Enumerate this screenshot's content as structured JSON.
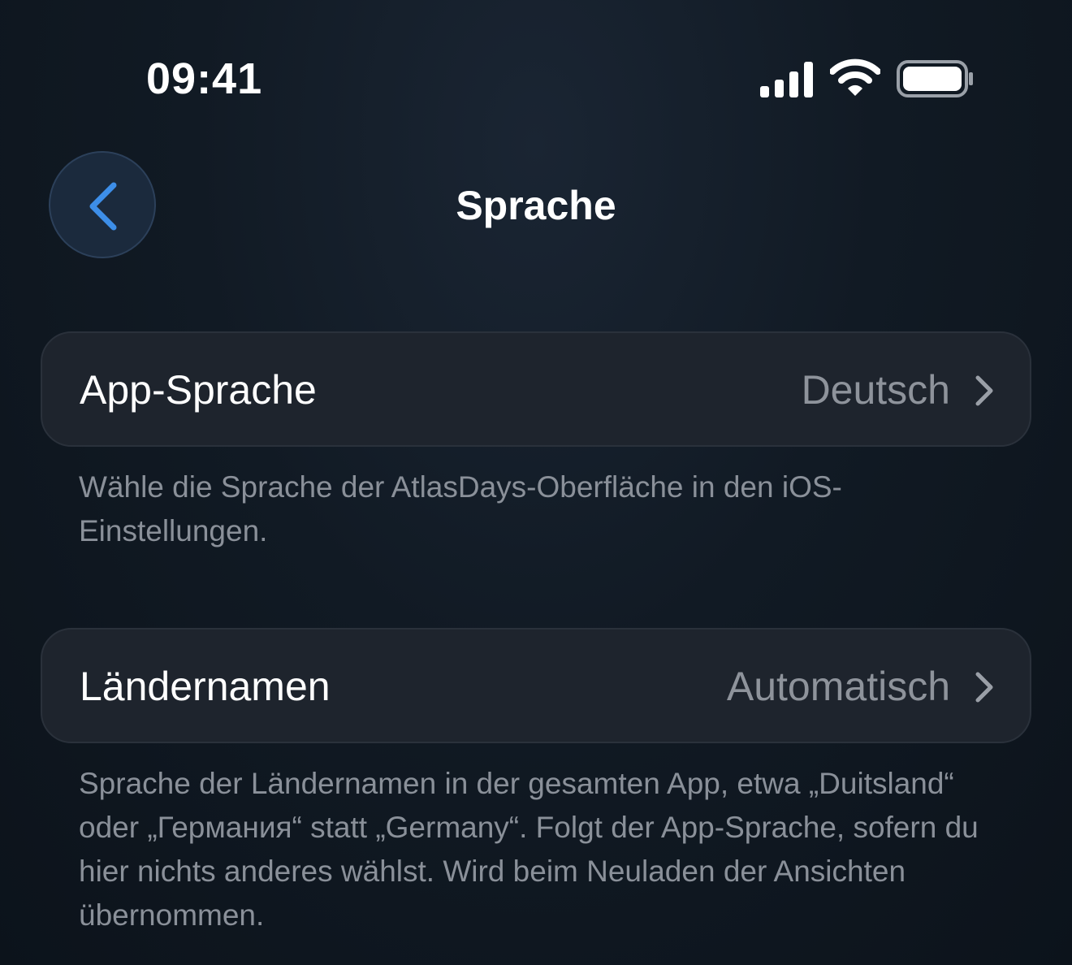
{
  "status_bar": {
    "time": "09:41",
    "icons": [
      "signal-icon",
      "wifi-icon",
      "battery-icon"
    ]
  },
  "nav": {
    "back_icon": "chevron-left-icon",
    "title": "Sprache"
  },
  "settings": {
    "app_language": {
      "label": "App-Sprache",
      "value": "Deutsch",
      "description": "Wähle die Sprache der AtlasDays-Oberfläche in den iOS-Einstellungen."
    },
    "country_names": {
      "label": "Ländernamen",
      "value": "Automatisch",
      "description": "Sprache der Ländernamen in der gesamten App, etwa „Duitsland“ oder „Германия“ statt „Germany“. Folgt der App-Sprache, sofern du hier nichts anderes wählst. Wird beim Neuladen der Ansichten übernommen."
    }
  },
  "colors": {
    "background": "#111a24",
    "card": "#1e242d",
    "accent": "#3d8ee8",
    "secondary_text": "#8e939b"
  }
}
